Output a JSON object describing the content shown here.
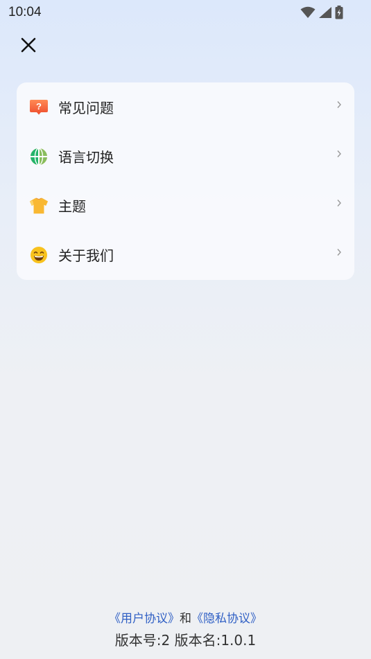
{
  "status_bar": {
    "time": "10:04",
    "icons": [
      "wifi-icon",
      "signal-icon",
      "battery-charging-icon"
    ]
  },
  "header": {
    "close_icon": "close-icon"
  },
  "menu": {
    "items": [
      {
        "label": "常见问题",
        "icon": "faq-icon",
        "icon_color": "#f5663a"
      },
      {
        "label": "语言切换",
        "icon": "globe-icon",
        "icon_color": "#27b36a"
      },
      {
        "label": "主题",
        "icon": "tshirt-icon",
        "icon_color": "#f7b733"
      },
      {
        "label": "关于我们",
        "icon": "smile-emoji-icon",
        "icon_color": "#f7c21c"
      }
    ]
  },
  "footer": {
    "user_agreement": "《用户协议》",
    "conjunction": "和",
    "privacy_policy": "《隐私协议》",
    "version": "版本号:2 版本名:1.0.1"
  },
  "colors": {
    "link": "#2f5fc4",
    "card_bg": "#f8fafd"
  }
}
